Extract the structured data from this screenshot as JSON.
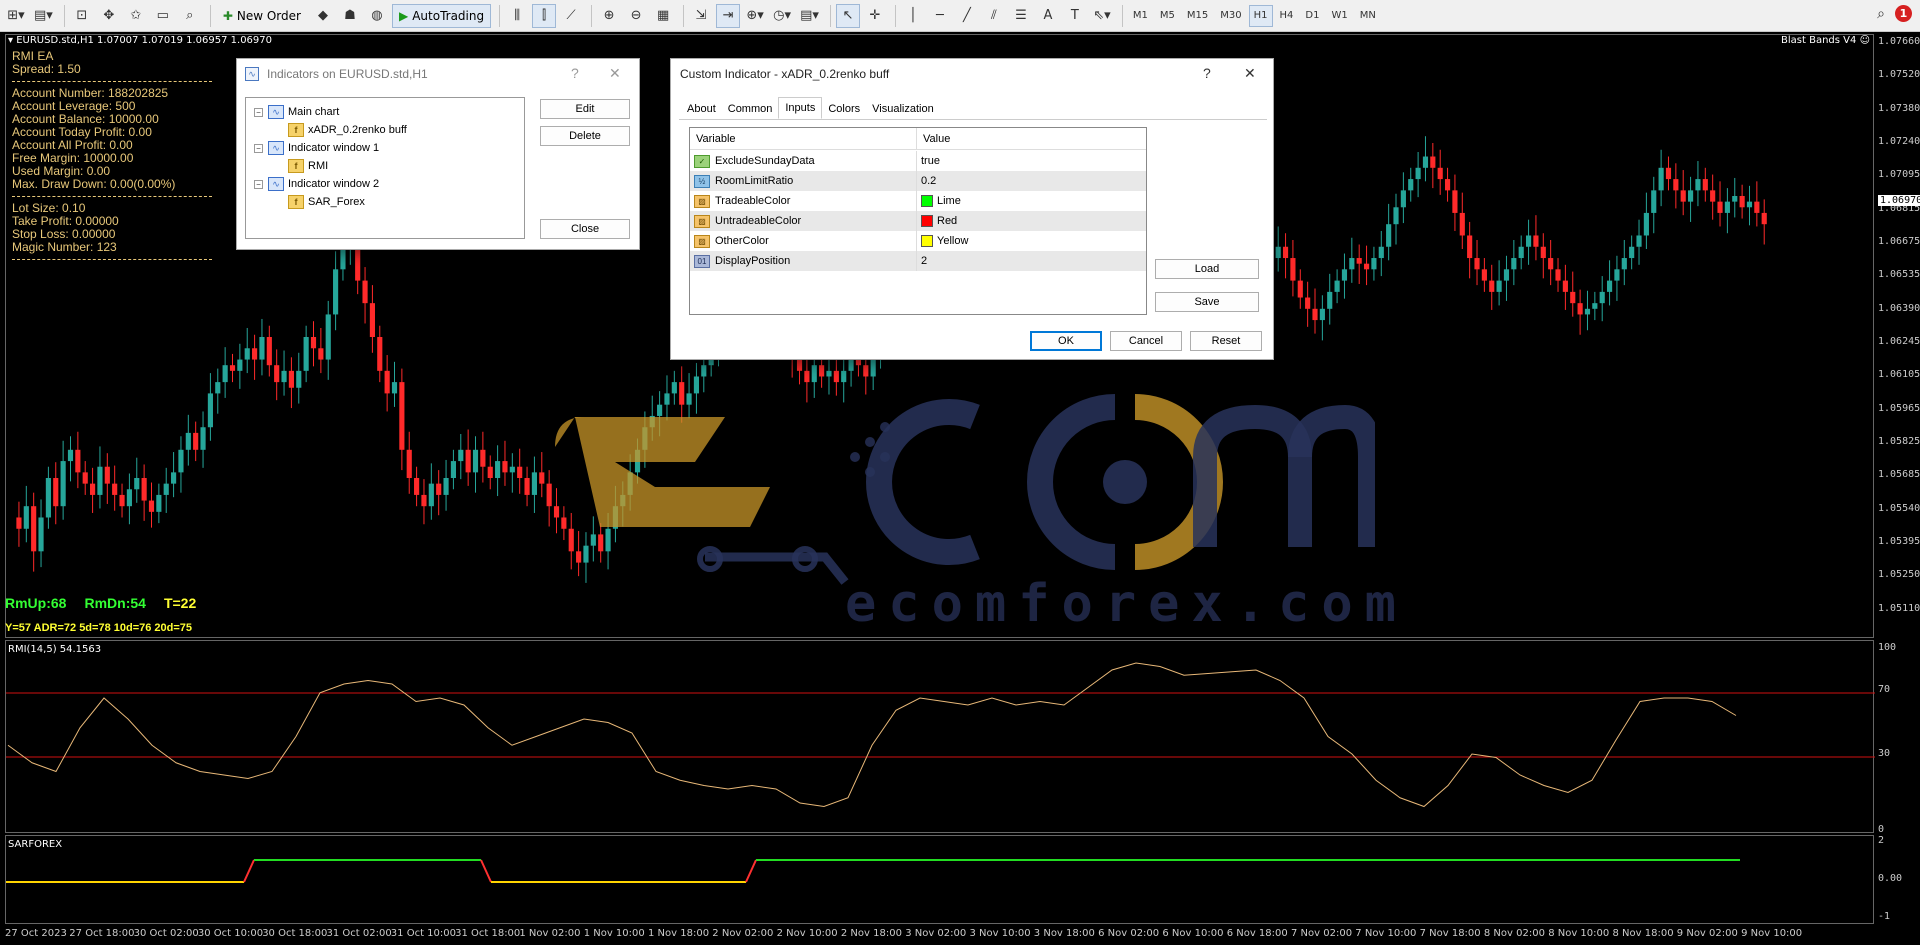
{
  "toolbar": {
    "new_order": "New Order",
    "auto_trading": "AutoTrading",
    "timeframes": [
      "M1",
      "M5",
      "M15",
      "M30",
      "H1",
      "H4",
      "D1",
      "W1",
      "MN"
    ],
    "active_timeframe": "H1",
    "notifications": "1"
  },
  "chart": {
    "title": "EURUSD.std,H1  1.07007 1.07019 1.06957 1.06970",
    "indicator_label": "Blast Bands V4",
    "current_price": "1.06970",
    "price_labels": [
      "1.07660",
      "1.07520",
      "1.07380",
      "1.07240",
      "1.07095",
      "1.06815",
      "1.06675",
      "1.06535",
      "1.06390",
      "1.06245",
      "1.06105",
      "1.05965",
      "1.05825",
      "1.05685",
      "1.05540",
      "1.05395",
      "1.05250",
      "1.05110"
    ],
    "rmi_scale": [
      "100",
      "70",
      "30",
      "0"
    ],
    "sar_scale": [
      "2",
      "0.00",
      "-1"
    ],
    "time_labels": [
      "27 Oct 2023",
      "27 Oct 18:00",
      "30 Oct 02:00",
      "30 Oct 10:00",
      "30 Oct 18:00",
      "31 Oct 02:00",
      "31 Oct 10:00",
      "31 Oct 18:00",
      "1 Nov 02:00",
      "1 Nov 10:00",
      "1 Nov 18:00",
      "2 Nov 02:00",
      "2 Nov 10:00",
      "2 Nov 18:00",
      "3 Nov 02:00",
      "3 Nov 10:00",
      "3 Nov 18:00",
      "6 Nov 02:00",
      "6 Nov 10:00",
      "6 Nov 18:00",
      "7 Nov 02:00",
      "7 Nov 10:00",
      "7 Nov 18:00",
      "8 Nov 02:00",
      "8 Nov 10:00",
      "8 Nov 18:00",
      "9 Nov 02:00",
      "9 Nov 10:00"
    ]
  },
  "ea_info": {
    "name": "RMI EA",
    "spread": "Spread: 1.50",
    "account_number": "Account Number: 188202825",
    "account_leverage": "Account Leverage: 500",
    "account_balance": "Account Balance: 10000.00",
    "account_today_profit": "Account Today Profit: 0.00",
    "account_all_profit": "Account All Profit: 0.00",
    "free_margin": "Free Margin: 10000.00",
    "used_margin": "Used Margin: 0.00",
    "max_draw_down": "Max. Draw Down: 0.00(0.00%)",
    "lot_size": "Lot Size: 0.10",
    "take_profit": "Take Profit: 0.00000",
    "stop_loss": "Stop Loss: 0.00000",
    "magic_number": "Magic Number: 123"
  },
  "rm_stats": {
    "up": "RmUp:68",
    "dn": "RmDn:54",
    "t": "T=22"
  },
  "adr_stats": "Y=57  ADR=72  5d=78  10d=76  20d=75",
  "rmi_label": "RMI(14,5) 54.1563",
  "sar_label": "SARFOREX",
  "watermark": {
    "text": "ecomforex.com"
  },
  "indicators_dialog": {
    "title": "Indicators on EURUSD.std,H1",
    "tree": [
      {
        "label": "Main chart",
        "level": 0
      },
      {
        "label": "xADR_0.2renko buff",
        "level": 1
      },
      {
        "label": "Indicator window 1",
        "level": 0
      },
      {
        "label": "RMI",
        "level": 1
      },
      {
        "label": "Indicator window 2",
        "level": 0
      },
      {
        "label": "SAR_Forex",
        "level": 1
      }
    ],
    "edit": "Edit",
    "delete": "Delete",
    "close": "Close"
  },
  "custom_dialog": {
    "title": "Custom Indicator - xADR_0.2renko buff",
    "tabs": [
      "About",
      "Common",
      "Inputs",
      "Colors",
      "Visualization"
    ],
    "active_tab": "Inputs",
    "col_variable": "Variable",
    "col_value": "Value",
    "inputs": [
      {
        "name": "ExcludeSundayData",
        "value": "true",
        "type": "bool"
      },
      {
        "name": "RoomLimitRatio",
        "value": "0.2",
        "type": "double"
      },
      {
        "name": "TradeableColor",
        "value": "Lime",
        "type": "color",
        "color": "#00ff00"
      },
      {
        "name": "UntradeableColor",
        "value": "Red",
        "type": "color",
        "color": "#ff0000"
      },
      {
        "name": "OtherColor",
        "value": "Yellow",
        "type": "color",
        "color": "#ffff00"
      },
      {
        "name": "DisplayPosition",
        "value": "2",
        "type": "int"
      }
    ],
    "load": "Load",
    "save": "Save",
    "ok": "OK",
    "cancel": "Cancel",
    "reset": "Reset"
  },
  "colors": {
    "bull": "#26a69a",
    "bear": "#ff2a2a",
    "rmi_line": "#e8b878",
    "level_line": "#d01010",
    "sar_up": "#22dd22",
    "sar_down": "#ffd400",
    "sar_switch": "#ff3030"
  }
}
